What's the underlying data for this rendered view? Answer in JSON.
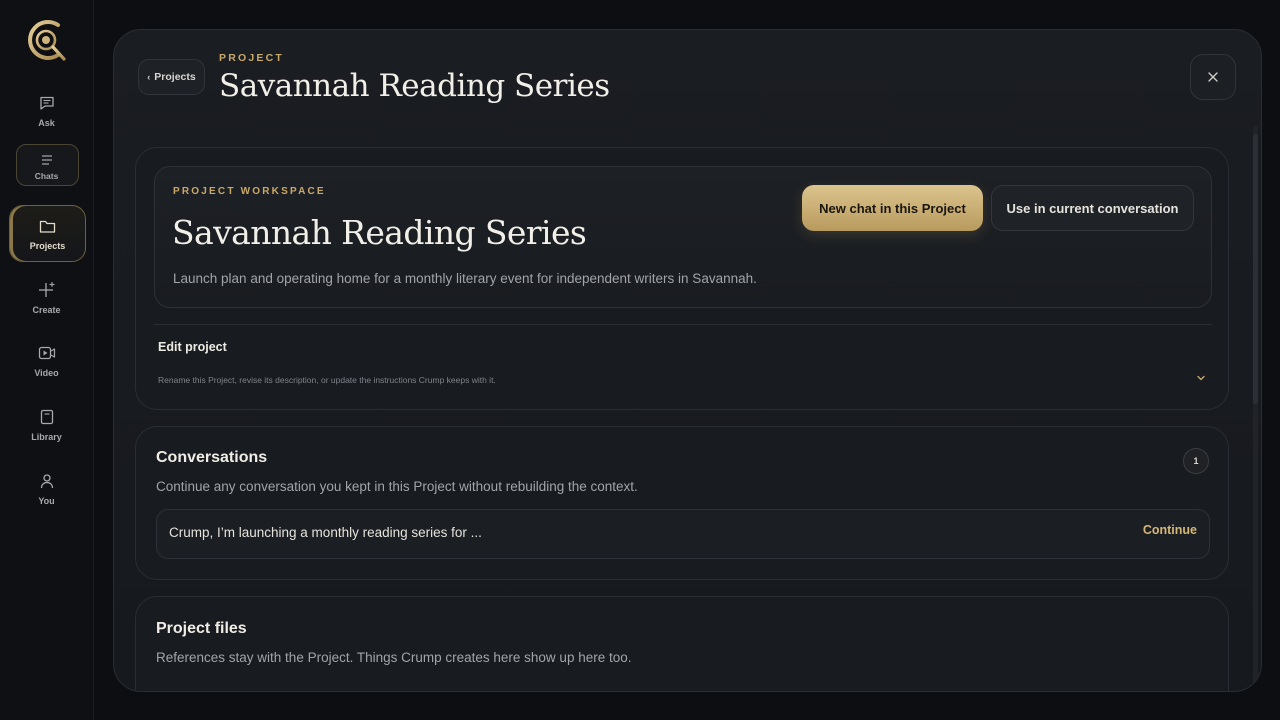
{
  "sidebar": {
    "items": [
      {
        "key": "ask",
        "label": "Ask",
        "icon": "chat-bubble-icon"
      },
      {
        "key": "chats",
        "label": "Chats",
        "icon": "lines-icon"
      },
      {
        "key": "projects",
        "label": "Projects",
        "icon": "folder-icon"
      },
      {
        "key": "create",
        "label": "Create",
        "icon": "sparkle-plus-icon"
      },
      {
        "key": "video",
        "label": "Video",
        "icon": "video-icon"
      },
      {
        "key": "library",
        "label": "Library",
        "icon": "book-icon"
      },
      {
        "key": "you",
        "label": "You",
        "icon": "user-icon"
      }
    ],
    "active": "projects"
  },
  "header": {
    "back_label": "Projects",
    "eyebrow": "PROJECT",
    "title": "Savannah Reading Series",
    "close_icon": "close-icon"
  },
  "workspace": {
    "eyebrow": "PROJECT WORKSPACE",
    "title": "Savannah Reading Series",
    "description": "Launch plan and operating home for a monthly literary event for independent writers in Savannah.",
    "primary_button": "New chat in this Project",
    "secondary_button": "Use in current conversation",
    "edit": {
      "title": "Edit project",
      "subtitle": "Rename this Project, revise its description, or update the instructions Crump keeps with it."
    }
  },
  "conversations": {
    "title": "Conversations",
    "subtitle": "Continue any conversation you kept in this Project without rebuilding the context.",
    "count": "1",
    "items": [
      {
        "text": "Crump, I’m launching a monthly reading series for ...",
        "action": "Continue"
      }
    ]
  },
  "files": {
    "title": "Project files",
    "subtitle": "References stay with the Project. Things Crump creates here show up here too."
  },
  "colors": {
    "accent_gold": "#c9a96a",
    "background": "#0c0e11",
    "panel": "#1a1d22"
  }
}
